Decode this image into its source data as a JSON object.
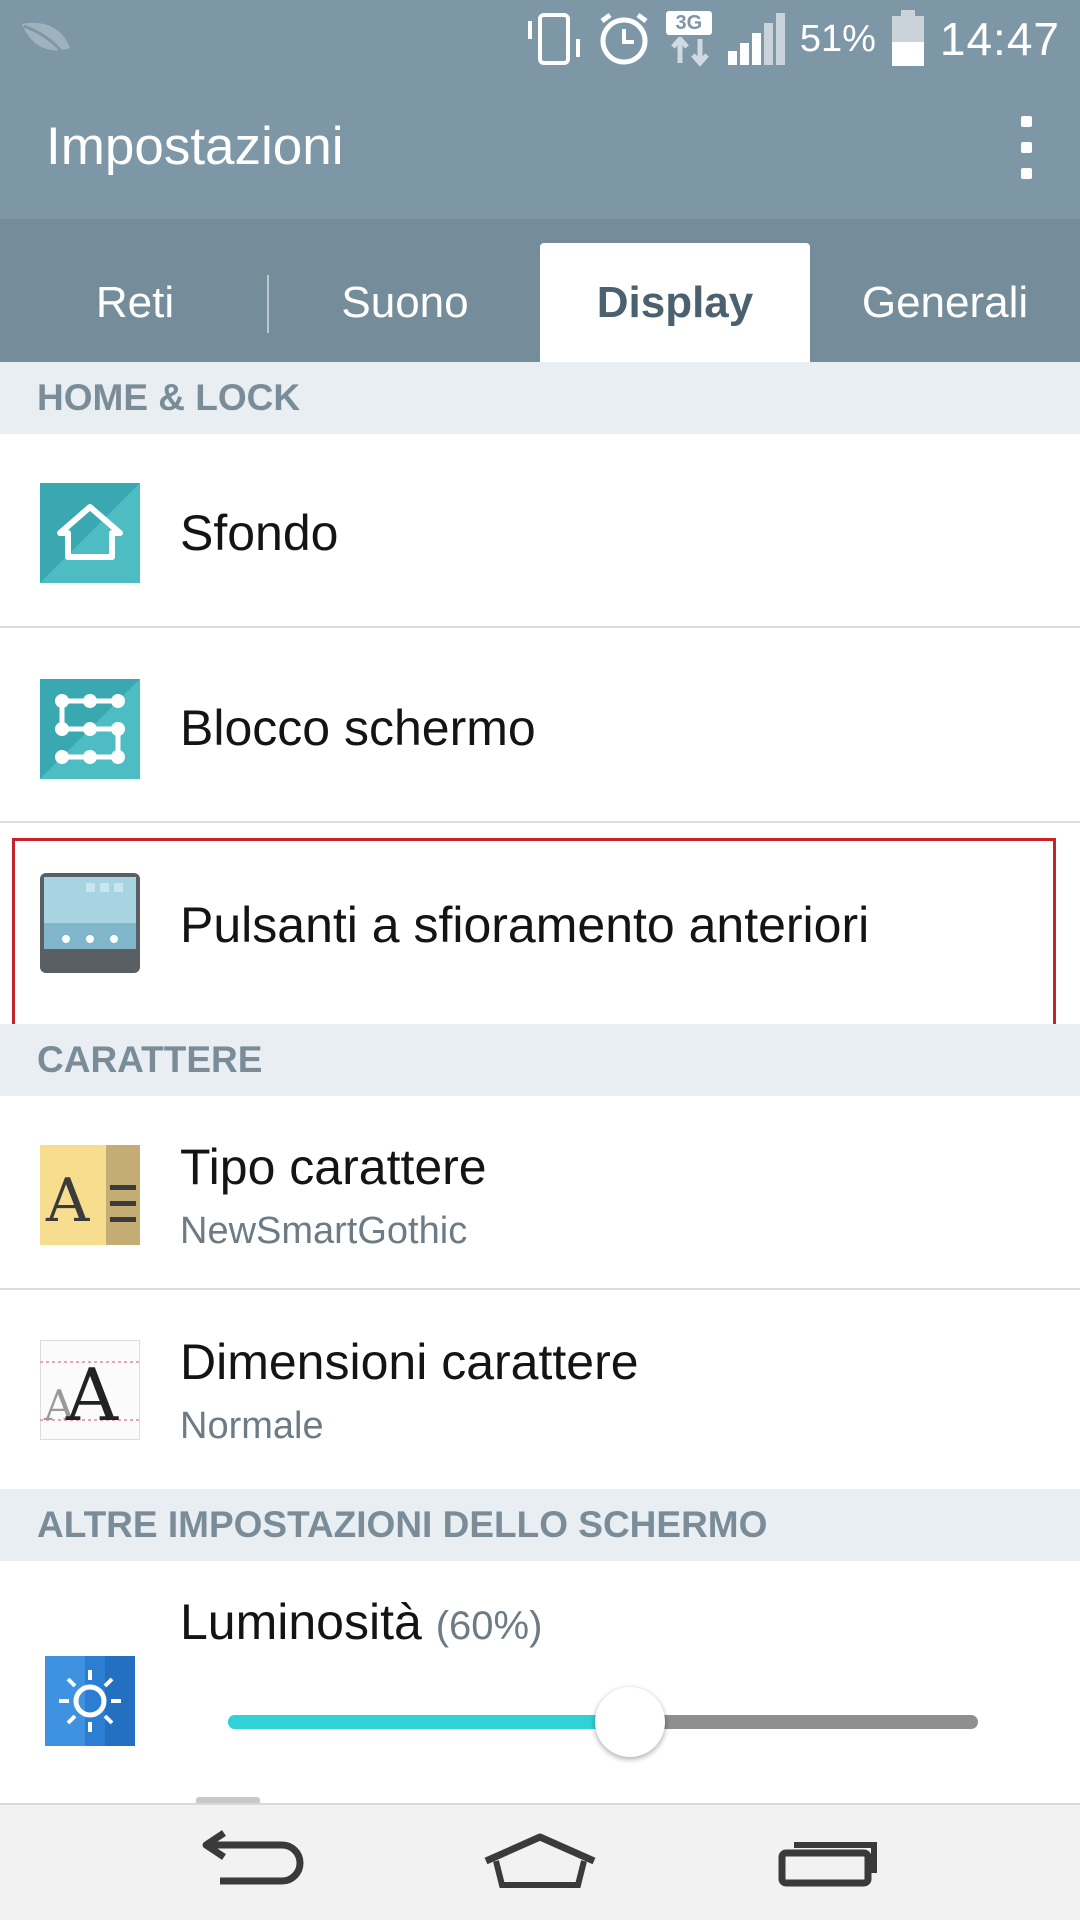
{
  "status_bar": {
    "battery_percent": "51%",
    "time": "14:47",
    "network": "3G",
    "icons": [
      "leaf-icon",
      "vibrate-icon",
      "alarm-icon",
      "network-3g-icon",
      "signal-icon",
      "battery-icon"
    ]
  },
  "action_bar": {
    "title": "Impostazioni",
    "overflow_icon": "overflow-menu-icon"
  },
  "tabs": [
    {
      "label": "Reti",
      "active": false
    },
    {
      "label": "Suono",
      "active": false
    },
    {
      "label": "Display",
      "active": true
    },
    {
      "label": "Generali",
      "active": false
    }
  ],
  "sections": {
    "home_lock": "HOME & LOCK",
    "carattere": "CARATTERE",
    "altre": "ALTRE IMPOSTAZIONI DELLO SCHERMO"
  },
  "items": {
    "sfondo": {
      "title": "Sfondo",
      "icon": "wallpaper-home-icon"
    },
    "blocco": {
      "title": "Blocco schermo",
      "icon": "lock-pattern-icon"
    },
    "pulsanti": {
      "title": "Pulsanti a sfioramento anteriori",
      "icon": "touch-buttons-icon",
      "highlighted": true
    },
    "tipo": {
      "title": "Tipo carattere",
      "subtitle": "NewSmartGothic",
      "icon": "font-type-icon"
    },
    "dimensioni": {
      "title": "Dimensioni carattere",
      "subtitle": "Normale",
      "icon": "font-size-icon"
    }
  },
  "brightness": {
    "title": "Luminosità",
    "value_text": "(60%)",
    "level": 0.6,
    "icon": "brightness-icon"
  },
  "nav_bar": {
    "icons": [
      "back-icon",
      "home-icon",
      "recent-apps-icon"
    ]
  },
  "colors": {
    "header": "#7e97a6",
    "tab_bar": "#758d9b",
    "active_tab_text": "#4b6170",
    "slider_fill": "#2fd3d7",
    "highlight_border": "#c8232c"
  }
}
